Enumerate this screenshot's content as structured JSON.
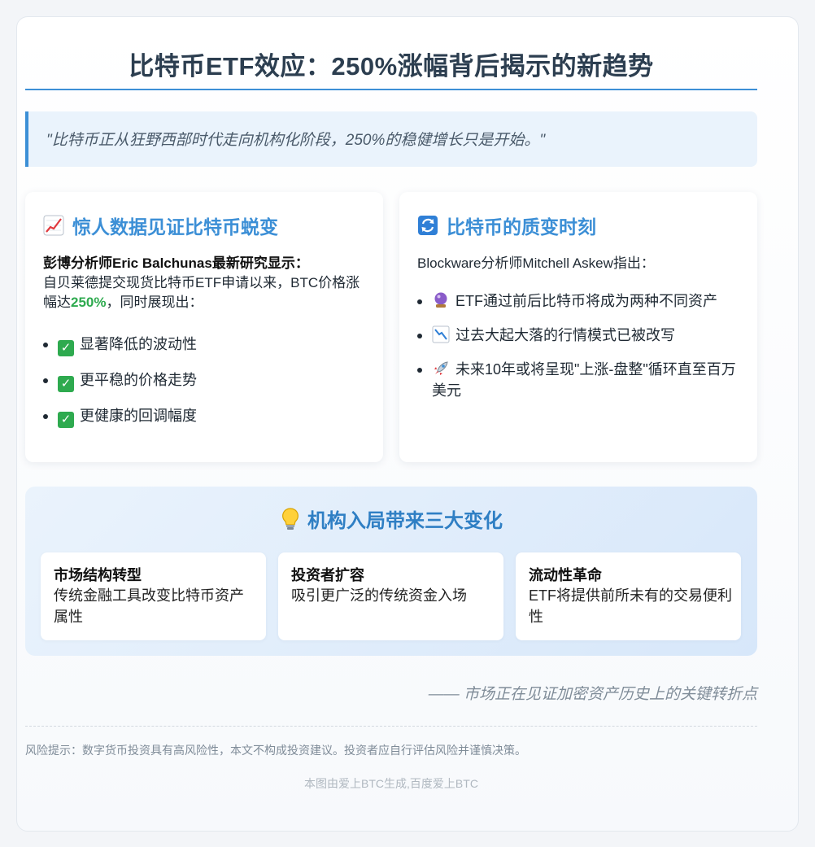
{
  "title": "比特币ETF效应：250%涨幅背后揭示的新趋势",
  "quote": "\"比特币正从狂野西部时代走向机构化阶段，250%的稳健增长只是开始。\"",
  "left_panel": {
    "icon": "chart-increasing-icon",
    "heading": "惊人数据见证比特币蜕变",
    "lead_bold": "彭博分析师Eric Balchunas最新研究显示：",
    "lead_text": "自贝莱德提交现货比特币ETF申请以来，BTC价格涨幅达",
    "lead_highlight": "250%",
    "lead_tail": "，同时展现出：",
    "items": [
      "显著降低的波动性",
      "更平稳的价格走势",
      "更健康的回调幅度"
    ],
    "accent_color": "#2eaa4f"
  },
  "right_panel": {
    "icon": "cycle-arrows-icon",
    "heading": "比特币的质变时刻",
    "lead_text": "Blockware分析师Mitchell Askew指出：",
    "items": [
      {
        "icon": "crystal-ball-icon",
        "text": "ETF通过前后比特币将成为两种不同资产"
      },
      {
        "icon": "chart-decreasing-icon",
        "text": "过去大起大落的行情模式已被改写"
      },
      {
        "icon": "rocket-icon",
        "text": "未来10年或将呈现\"上涨-盘整\"循环直至百万美元"
      }
    ]
  },
  "changes": {
    "icon": "lightbulb-icon",
    "heading": "机构入局带来三大变化",
    "cards": [
      {
        "title": "市场结构转型",
        "text": "传统金融工具改变比特币资产属性"
      },
      {
        "title": "投资者扩容",
        "text": "吸引更广泛的传统资金入场"
      },
      {
        "title": "流动性革命",
        "text": "ETF将提供前所未有的交易便利性"
      }
    ]
  },
  "closing": "—— 市场正在见证加密资产历史上的关键转折点",
  "risk_note": "风险提示：数字货币投资具有高风险性，本文不构成投资建议。投资者应自行评估风险并谨慎决策。",
  "credit": "本图由爱上BTC生成,百度爱上BTC",
  "colors": {
    "accent": "#3c8fd6",
    "title": "#2c3e50"
  }
}
